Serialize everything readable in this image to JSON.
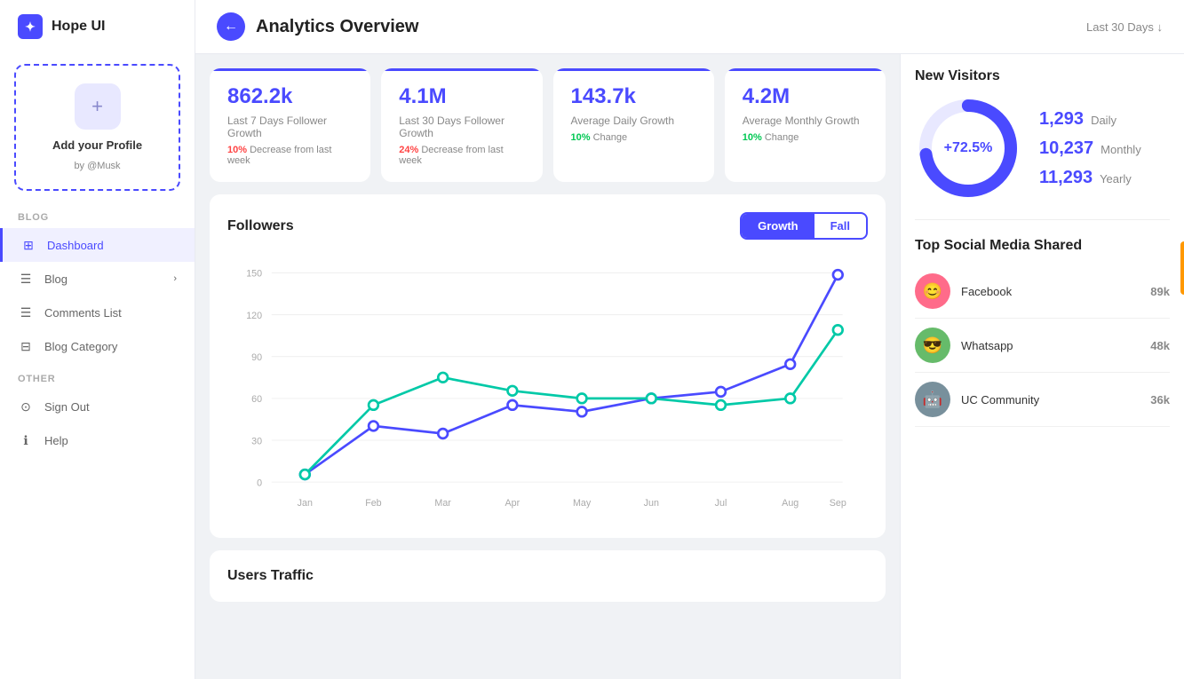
{
  "app": {
    "name": "Hope UI",
    "back_button": "←",
    "page_title": "Analytics Overview",
    "date_range": "Last 30 Days ↓"
  },
  "sidebar": {
    "profile": {
      "add_label": "+",
      "name": "Add your Profile",
      "handle": "by @Musk"
    },
    "sections": [
      {
        "label": "BLOG",
        "items": [
          {
            "id": "dashboard",
            "icon": "⊞",
            "text": "Dashboard",
            "active": true,
            "has_chevron": false
          },
          {
            "id": "blog",
            "icon": "☰",
            "text": "Blog",
            "active": false,
            "has_chevron": true
          },
          {
            "id": "comments",
            "icon": "☰",
            "text": "Comments List",
            "active": false,
            "has_chevron": false
          },
          {
            "id": "blog-cat",
            "icon": "⊟",
            "text": "Blog Category",
            "active": false,
            "has_chevron": false
          }
        ]
      },
      {
        "label": "OTHER",
        "items": [
          {
            "id": "signout",
            "icon": "⊙",
            "text": "Sign Out",
            "active": false,
            "has_chevron": false
          },
          {
            "id": "help",
            "icon": "ℹ",
            "text": "Help",
            "active": false,
            "has_chevron": false
          }
        ]
      }
    ]
  },
  "stats": [
    {
      "value": "862.2k",
      "label": "Last 7 Days Follower Growth",
      "change_pct": "10%",
      "change_text": "Decrease from last week",
      "change_type": "decrease"
    },
    {
      "value": "4.1M",
      "label": "Last 30 Days Follower Growth",
      "change_pct": "24%",
      "change_text": "Decrease from last week",
      "change_type": "decrease"
    },
    {
      "value": "143.7k",
      "label": "Average Daily Growth",
      "change_pct": "10%",
      "change_text": "Change",
      "change_type": "increase"
    },
    {
      "value": "4.2M",
      "label": "Average Monthly Growth",
      "change_pct": "10%",
      "change_text": "Change",
      "change_type": "increase"
    }
  ],
  "followers_chart": {
    "title": "Followers",
    "toggle": {
      "growth_label": "Growth",
      "fall_label": "Fall"
    },
    "y_labels": [
      "0",
      "30",
      "60",
      "90",
      "120",
      "150"
    ],
    "x_labels": [
      "Jan",
      "Feb",
      "Mar",
      "Apr",
      "May",
      "Jun",
      "Jul",
      "Aug",
      "Sep"
    ],
    "series_blue": [
      5,
      40,
      35,
      55,
      50,
      60,
      65,
      85,
      148
    ],
    "series_teal": [
      5,
      55,
      75,
      65,
      60,
      60,
      55,
      60,
      110
    ]
  },
  "new_visitors": {
    "title": "New Visitors",
    "donut_label": "+72.5%",
    "stats": [
      {
        "value": "1,293",
        "period": "Daily"
      },
      {
        "value": "10,237",
        "period": "Monthly"
      },
      {
        "value": "11,293",
        "period": "Yearly"
      }
    ]
  },
  "social_media": {
    "title": "Top Social Media Shared",
    "items": [
      {
        "name": "Facebook",
        "count": "89k",
        "color": "#ff6b6b",
        "emoji": "😊"
      },
      {
        "name": "Whatsapp",
        "count": "48k",
        "color": "#66bb6a",
        "emoji": "😎"
      },
      {
        "name": "UC Community",
        "count": "36k",
        "color": "#78909c",
        "emoji": "🤖"
      }
    ]
  },
  "users_traffic": {
    "title": "Users Traffic"
  }
}
